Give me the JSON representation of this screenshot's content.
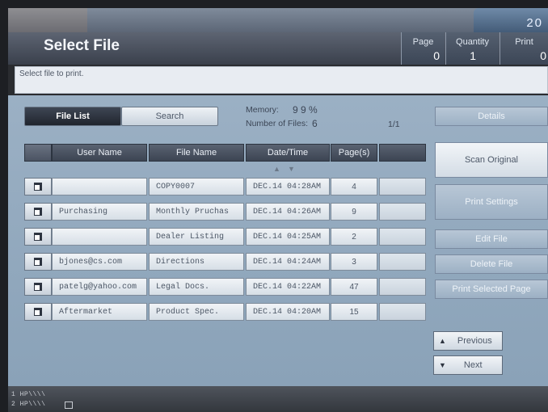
{
  "header": {
    "title": "Select File",
    "top_counter": "20",
    "page_label": "Page",
    "page_value": "0",
    "quantity_label": "Quantity",
    "quantity_value": "1",
    "print_label": "Print",
    "print_value": "0"
  },
  "instruction": "Select file to print.",
  "tabs": {
    "file_list": "File List",
    "search": "Search"
  },
  "info": {
    "memory_label": "Memory:",
    "memory_value": "9 9 %",
    "files_label": "Number of Files:",
    "files_value": "6",
    "page_indicator": "1/1"
  },
  "table": {
    "columns": [
      "User Name",
      "File Name",
      "Date/Time",
      "Page(s)"
    ],
    "sort_up": "▲",
    "sort_down": "▼",
    "rows": [
      {
        "user": "",
        "file": "COPY0007",
        "date": "DEC.14  04:28AM",
        "pages": "4"
      },
      {
        "user": "Purchasing",
        "file": "Monthly Pruchas",
        "date": "DEC.14  04:26AM",
        "pages": "9"
      },
      {
        "user": "",
        "file": "Dealer Listing",
        "date": "DEC.14  04:25AM",
        "pages": "2"
      },
      {
        "user": "bjones@cs.com",
        "file": "Directions",
        "date": "DEC.14  04:24AM",
        "pages": "3"
      },
      {
        "user": "patelg@yahoo.com",
        "file": "Legal Docs.",
        "date": "DEC.14  04:22AM",
        "pages": "47"
      },
      {
        "user": "Aftermarket",
        "file": "Product Spec.",
        "date": "DEC.14  04:20AM",
        "pages": "15"
      }
    ]
  },
  "right_buttons": {
    "details": "Details",
    "scan_original": "Scan Original",
    "print_settings": "Print Settings",
    "edit_file": "Edit File",
    "delete_file": "Delete File",
    "print_selected_page": "Print Selected Page",
    "previous": "Previous",
    "next": "Next",
    "previous_arrow": "▲",
    "next_arrow": "▼"
  },
  "status": {
    "line1": "1 HP\\\\\\\\",
    "line2": "2 HP\\\\\\\\"
  }
}
